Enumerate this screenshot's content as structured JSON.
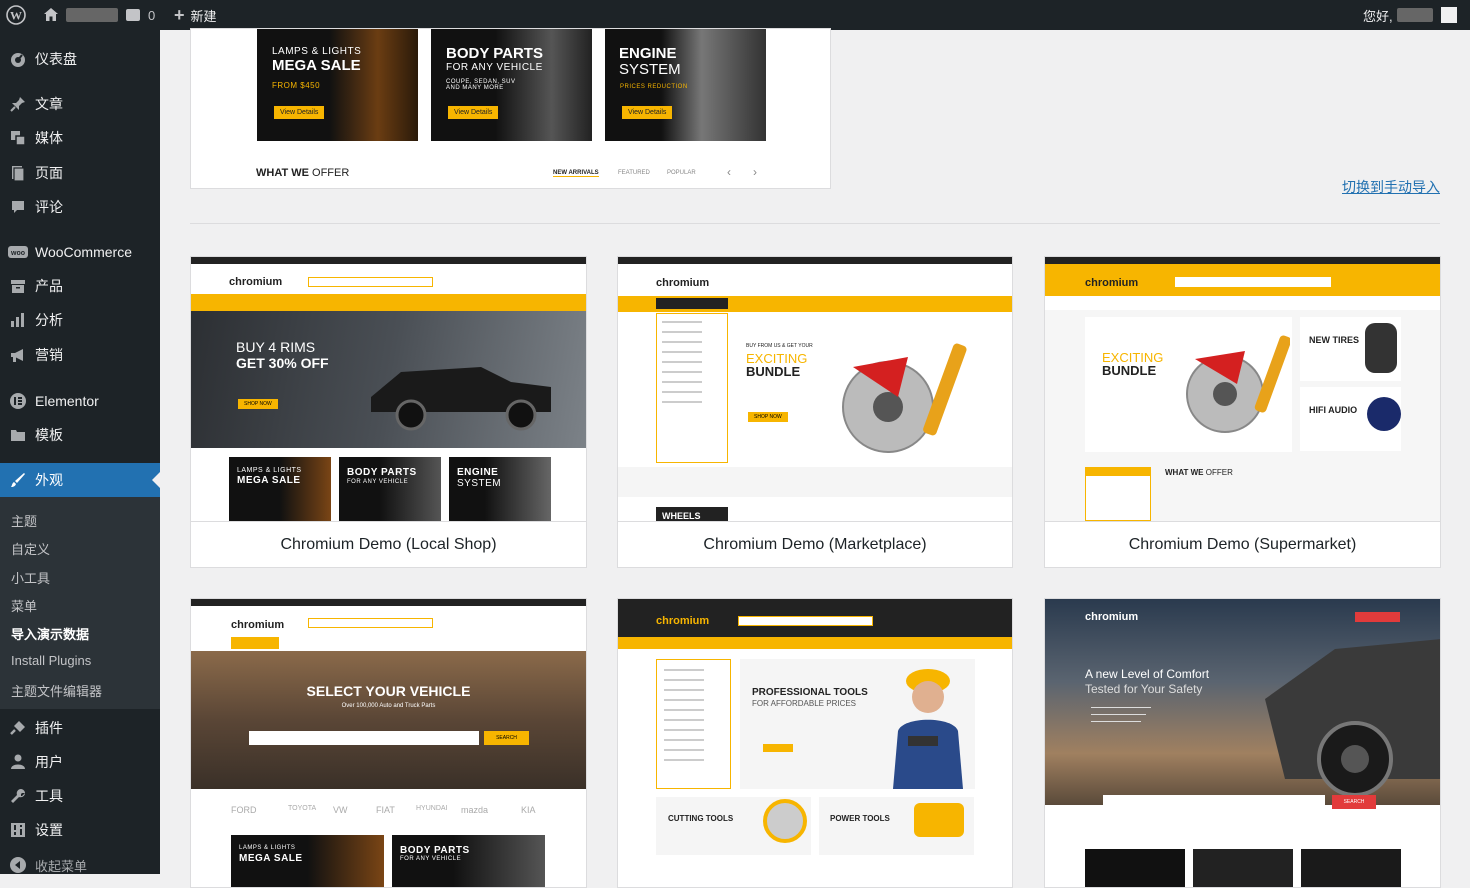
{
  "adminbar": {
    "comment_count": "0",
    "new_label": "新建",
    "greeting": "您好,"
  },
  "sidebar": {
    "items": [
      {
        "label": "仪表盘",
        "icon": "dashboard-icon"
      },
      {
        "label": "文章",
        "icon": "pin-icon"
      },
      {
        "label": "媒体",
        "icon": "media-icon"
      },
      {
        "label": "页面",
        "icon": "page-icon"
      },
      {
        "label": "评论",
        "icon": "comment-icon"
      },
      {
        "label": "WooCommerce",
        "icon": "woo-icon"
      },
      {
        "label": "产品",
        "icon": "archive-icon"
      },
      {
        "label": "分析",
        "icon": "bar-chart-icon"
      },
      {
        "label": "营销",
        "icon": "megaphone-icon"
      },
      {
        "label": "Elementor",
        "icon": "elementor-icon"
      },
      {
        "label": "模板",
        "icon": "folder-icon"
      },
      {
        "label": "外观",
        "icon": "brush-icon"
      },
      {
        "label": "插件",
        "icon": "plugin-icon"
      },
      {
        "label": "用户",
        "icon": "user-icon"
      },
      {
        "label": "工具",
        "icon": "wrench-icon"
      },
      {
        "label": "设置",
        "icon": "settings-icon"
      },
      {
        "label": "收起菜单",
        "icon": "collapse-icon"
      }
    ],
    "submenu": [
      "主题",
      "自定义",
      "小工具",
      "菜单",
      "导入演示数据",
      "Install Plugins",
      "主题文件编辑器"
    ]
  },
  "top_preview": {
    "banners": [
      {
        "line1": "LAMPS & LIGHTS",
        "line2": "MEGA SALE",
        "extra": "FROM $450",
        "button": "View Details"
      },
      {
        "line1": "BODY PARTS",
        "line2": "FOR ANY VEHICLE",
        "extra": "COUPE, SEDAN, SUV AND MANY MORE",
        "button": "View Details"
      },
      {
        "line1": "ENGINE",
        "line2": "SYSTEM",
        "extra": "PRICES REDUCTION",
        "button": "View Details"
      }
    ],
    "offer_heading_bold": "WHAT WE",
    "offer_heading_rest": "OFFER",
    "tabs": [
      "NEW ARRIVALS",
      "FEATURED",
      "POPULAR"
    ]
  },
  "switch_link": "切换到手动导入",
  "demos": [
    {
      "name": "Chromium Demo (Local Shop)",
      "logo": "chromium",
      "hero_line1": "BUY 4 RIMS",
      "hero_line2": "GET 30% OFF",
      "hero_button": "SHOP NOW",
      "banners": [
        "MEGA SALE",
        "BODY PARTS",
        "ENGINE"
      ],
      "sublabels": [
        "LAMPS & LIGHTS",
        "FOR ANY VEHICLE",
        "SYSTEM"
      ]
    },
    {
      "name": "Chromium Demo (Marketplace)",
      "logo": "chromium",
      "hero_kicker": "BUY FROM US & GET YOUR",
      "hero_line1": "EXCITING",
      "hero_line2": "BUNDLE",
      "hero_button": "SHOP NOW",
      "footer_word": "WHEELS"
    },
    {
      "name": "Chromium Demo (Supermarket)",
      "logo": "chromium",
      "hero_line1": "EXCITING",
      "hero_line2": "BUNDLE",
      "side1": "NEW TIRES",
      "side2": "HIFI AUDIO",
      "offer_bold": "WHAT WE",
      "offer_rest": "OFFER"
    },
    {
      "name": "",
      "logo": "chromium",
      "hero_line1": "SELECT YOUR VEHICLE",
      "hero_line2": "Over 100,000 Auto and Truck Parts",
      "hero_button": "SEARCH",
      "brands": [
        "FORD",
        "TOYOTA",
        "VW",
        "FIAT",
        "HYUNDAI",
        "mazda",
        "KIA"
      ],
      "banners": [
        "MEGA SALE",
        "BODY PARTS"
      ],
      "sublabels": [
        "LAMPS & LIGHTS",
        "FOR ANY VEHICLE"
      ]
    },
    {
      "name": "",
      "logo": "chromium",
      "hero_line1": "PROFESSIONAL TOOLS",
      "hero_line2": "FOR AFFORDABLE PRICES",
      "tile1": "CUTTING TOOLS",
      "tile2": "POWER TOOLS"
    },
    {
      "name": "",
      "logo": "chromium",
      "hero_line1": "A new Level of Comfort",
      "hero_line2": "Tested for Your Safety",
      "hero_button": "SEARCH"
    }
  ],
  "colors": {
    "accent": "#f7b500",
    "wp_blue": "#2271b1",
    "admin_dark": "#1d2327"
  }
}
